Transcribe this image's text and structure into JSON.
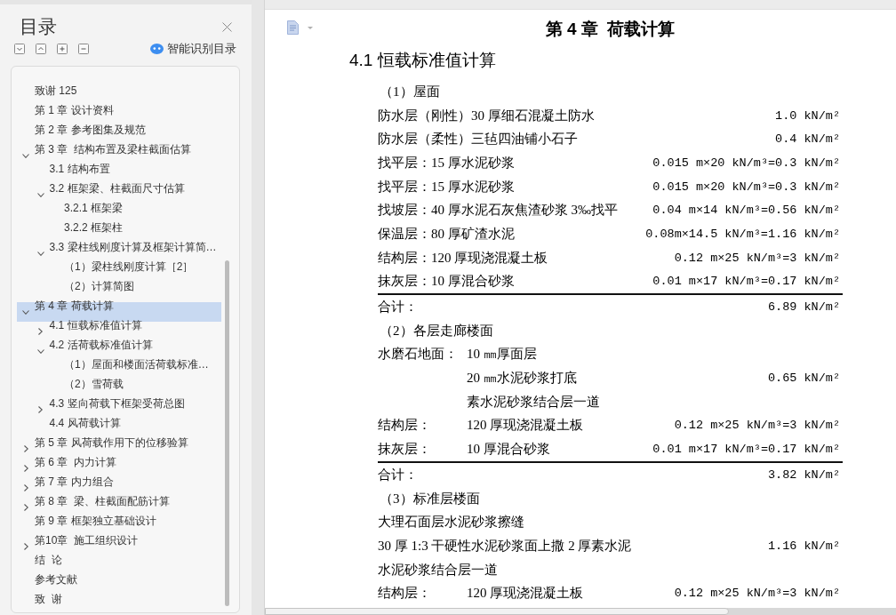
{
  "sidebar": {
    "title": "目录",
    "smart_toc_button": "智能识别目录",
    "toc": [
      {
        "label": "致谢 125",
        "selected": false
      },
      {
        "label": "第 1 章 设计资料",
        "selected": false
      },
      {
        "label": "第 2 章 参考图集及规范",
        "selected": false
      },
      {
        "label": "第 3 章  结构布置及梁柱截面估算",
        "selected": false,
        "expanded": true,
        "children": [
          {
            "label": "3.1 结构布置",
            "selected": false
          },
          {
            "label": "3.2 框架梁、柱截面尺寸估算",
            "selected": false,
            "expanded": true,
            "children": [
              {
                "label": "3.2.1 框架梁",
                "selected": false
              },
              {
                "label": "3.2.2 框架柱",
                "selected": false
              }
            ]
          },
          {
            "label": "3.3 梁柱线刚度计算及框架计算简…",
            "selected": false,
            "expanded": true,
            "children": [
              {
                "label": "（1）梁柱线刚度计算［2］",
                "selected": false
              },
              {
                "label": "（2）计算简图",
                "selected": false
              }
            ]
          }
        ]
      },
      {
        "label": "第 4 章 荷载计算",
        "selected": true,
        "expanded": true,
        "children": [
          {
            "label": "4.1 恒载标准值计算",
            "selected": false,
            "expanded": false
          },
          {
            "label": "4.2 活荷载标准值计算",
            "selected": false,
            "expanded": true,
            "children": [
              {
                "label": "（1）屋面和楼面活荷载标准…",
                "selected": false
              },
              {
                "label": "（2）雪荷载",
                "selected": false
              }
            ]
          },
          {
            "label": "4.3 竖向荷载下框架受荷总图",
            "selected": false,
            "expanded": false
          },
          {
            "label": "4.4 风荷载计算",
            "selected": false
          }
        ]
      },
      {
        "label": "第 5 章 风荷载作用下的位移验算",
        "selected": false,
        "expanded": false
      },
      {
        "label": "第 6 章  内力计算",
        "selected": false,
        "expanded": false
      },
      {
        "label": "第 7 章 内力组合",
        "selected": false,
        "expanded": false
      },
      {
        "label": "第 8 章  梁、柱截面配筋计算",
        "selected": false,
        "expanded": false
      },
      {
        "label": "第 9 章 框架独立基础设计",
        "selected": false
      },
      {
        "label": "第10章  施工组织设计",
        "selected": false,
        "expanded": false
      },
      {
        "label": "结  论",
        "selected": false
      },
      {
        "label": "参考文献",
        "selected": false
      },
      {
        "label": "致  谢",
        "selected": false
      }
    ]
  },
  "document": {
    "chapter_title": "第 4 章  荷载计算",
    "section_title": "4.1 恒载标准值计算",
    "lines": [
      {
        "kind": "subheading",
        "text": "（1）屋面"
      },
      {
        "kind": "row",
        "text": "防水层（刚性）30 厚细石混凝土防水",
        "value": "1.0 kN/m²"
      },
      {
        "kind": "row",
        "text": "防水层（柔性）三毡四油铺小石子",
        "value": "0.4 kN/m²"
      },
      {
        "kind": "row",
        "text": "找平层：15 厚水泥砂浆",
        "value": "0.015 m×20 kN/m³=0.3 kN/m²"
      },
      {
        "kind": "row",
        "text": "找平层：15 厚水泥砂浆",
        "value": "0.015 m×20 kN/m³=0.3 kN/m²"
      },
      {
        "kind": "row",
        "text": "找坡层：40 厚水泥石灰焦渣砂浆 3‰找平",
        "value": "0.04 m×14 kN/m³=0.56 kN/m²"
      },
      {
        "kind": "row",
        "text": "保温层：80 厚矿渣水泥",
        "value": "0.08m×14.5 kN/m³=1.16 kN/m²"
      },
      {
        "kind": "row",
        "text": "结构层：120 厚现浇混凝土板",
        "value": "0.12 m×25 kN/m³=3 kN/m²"
      },
      {
        "kind": "row",
        "text": "抹灰层：10 厚混合砂浆",
        "value": "0.01 m×17 kN/m³=0.17 kN/m²"
      },
      {
        "kind": "total",
        "text": "合计：",
        "value": "6.89 kN/m²"
      },
      {
        "kind": "subheading",
        "text": "（2）各层走廊楼面"
      },
      {
        "kind": "labeled",
        "label": "水磨石地面：",
        "text": "10 ㎜厚面层"
      },
      {
        "kind": "indented",
        "text": "20 ㎜水泥砂浆打底",
        "value": "0.65 kN/m²"
      },
      {
        "kind": "indented",
        "text": "素水泥砂浆结合层一道"
      },
      {
        "kind": "labeled",
        "label": "结构层：",
        "text": "120 厚现浇混凝土板",
        "value": "0.12 m×25 kN/m³=3 kN/m²"
      },
      {
        "kind": "labeled",
        "label": "抹灰层：",
        "text": "10 厚混合砂浆",
        "value": "0.01 m×17 kN/m³=0.17 kN/m²"
      },
      {
        "kind": "total",
        "text": "合计：",
        "value": "3.82 kN/m²"
      },
      {
        "kind": "subheading",
        "text": "（3）标准层楼面"
      },
      {
        "kind": "row",
        "text": "大理石面层水泥砂浆擦缝"
      },
      {
        "kind": "row",
        "text": "30 厚 1:3 干硬性水泥砂浆面上撒 2 厚素水泥",
        "value": "1.16 kN/m²"
      },
      {
        "kind": "row",
        "text": "水泥砂浆结合层一道"
      },
      {
        "kind": "labeled",
        "label": "结构层：",
        "text": "120 厚现浇混凝土板",
        "value": "0.12 m×25 kN/m³=3 kN/m²"
      }
    ]
  }
}
